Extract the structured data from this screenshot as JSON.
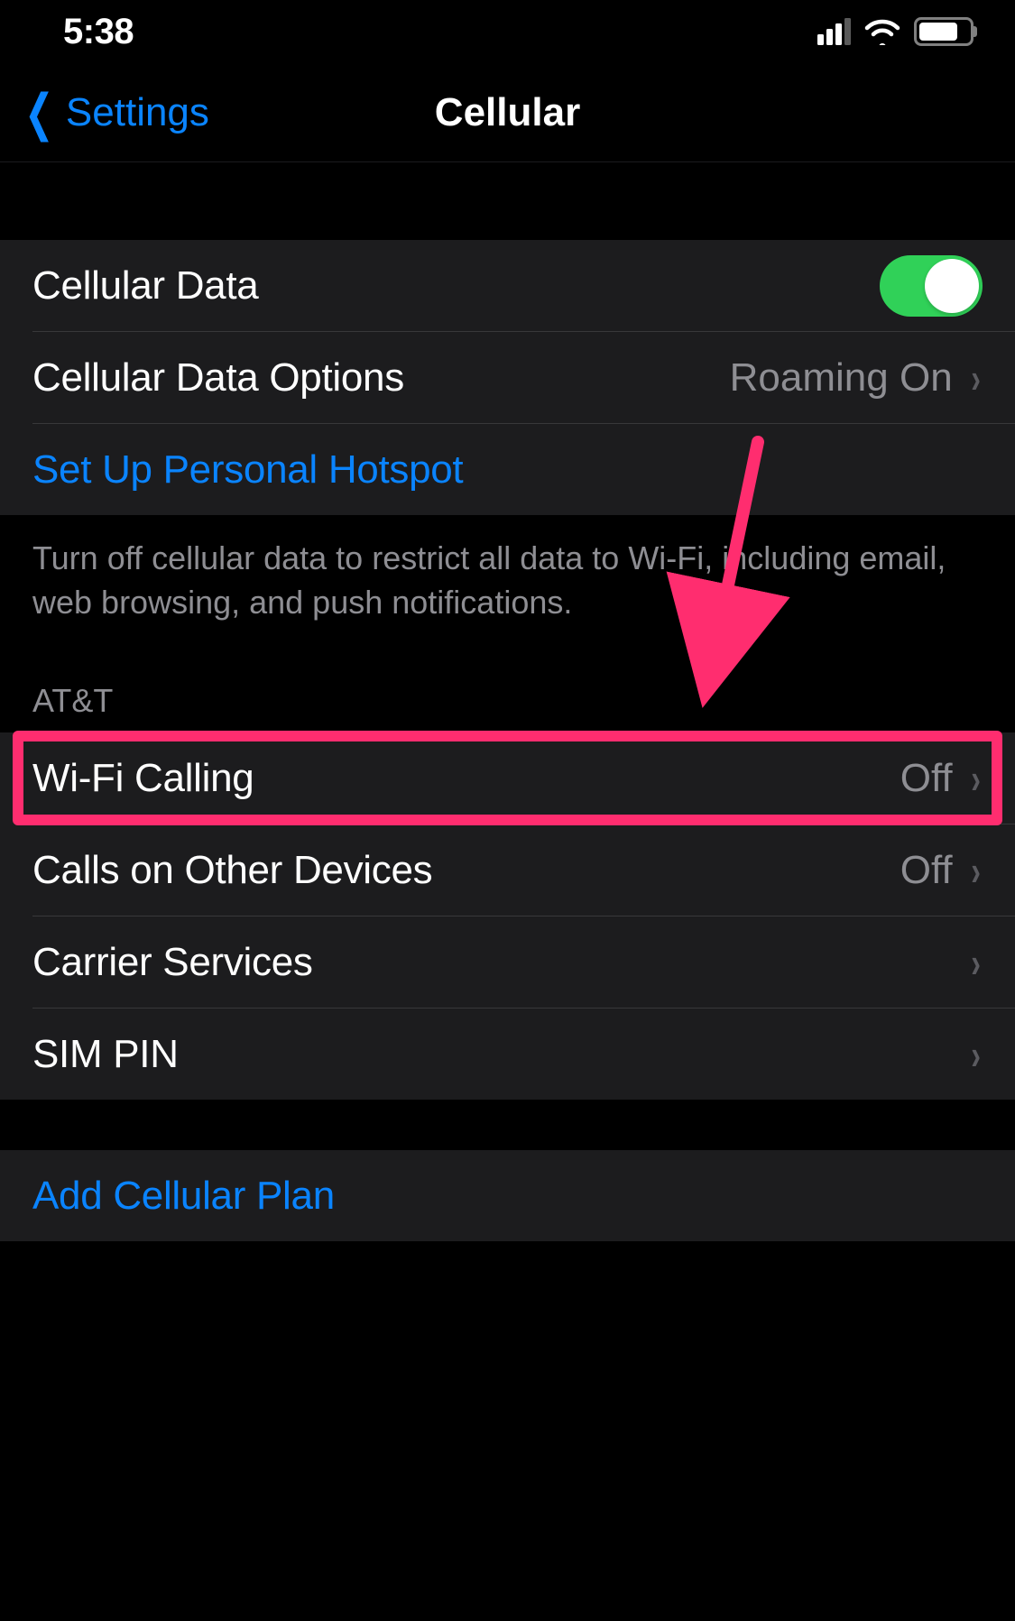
{
  "status": {
    "time": "5:38"
  },
  "nav": {
    "back_label": "Settings",
    "title": "Cellular"
  },
  "group1": {
    "cellular_data_label": "Cellular Data",
    "cellular_data_options_label": "Cellular Data Options",
    "cellular_data_options_value": "Roaming On",
    "personal_hotspot_label": "Set Up Personal Hotspot",
    "footer": "Turn off cellular data to restrict all data to Wi-Fi, including email, web browsing, and push notifications."
  },
  "group2": {
    "header": "AT&T",
    "wifi_calling_label": "Wi-Fi Calling",
    "wifi_calling_value": "Off",
    "calls_other_label": "Calls on Other Devices",
    "calls_other_value": "Off",
    "carrier_services_label": "Carrier Services",
    "sim_pin_label": "SIM PIN"
  },
  "group3": {
    "add_plan_label": "Add Cellular Plan"
  }
}
